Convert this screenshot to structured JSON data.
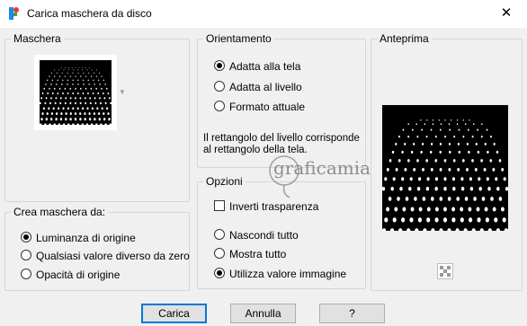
{
  "window": {
    "title": "Carica maschera da disco",
    "close_label": "✕"
  },
  "maschera": {
    "label": "Maschera"
  },
  "crea": {
    "label": "Crea maschera da:",
    "options": [
      {
        "label": "Luminanza di origine",
        "selected": true
      },
      {
        "label": "Qualsiasi valore diverso da zero",
        "selected": false
      },
      {
        "label": "Opacità di origine",
        "selected": false
      }
    ]
  },
  "orientamento": {
    "label": "Orientamento",
    "options": [
      {
        "label": "Adatta alla tela",
        "selected": true
      },
      {
        "label": "Adatta al livello",
        "selected": false
      },
      {
        "label": "Formato attuale",
        "selected": false
      }
    ],
    "info": "Il rettangolo del livello corrisponde al rettangolo della tela."
  },
  "opzioni": {
    "label": "Opzioni",
    "invert_label": "Inverti trasparenza",
    "invert_checked": false,
    "options": [
      {
        "label": "Nascondi tutto",
        "selected": false
      },
      {
        "label": "Mostra tutto",
        "selected": false
      },
      {
        "label": "Utilizza valore immagine",
        "selected": true
      }
    ]
  },
  "anteprima": {
    "label": "Anteprima"
  },
  "buttons": {
    "load": "Carica",
    "cancel": "Annulla",
    "help": "?"
  },
  "watermark": {
    "text": "graficamia"
  },
  "colors": {
    "accent": "#0078d7",
    "border": "#d6d6d6",
    "background": "#f0f0f0"
  }
}
